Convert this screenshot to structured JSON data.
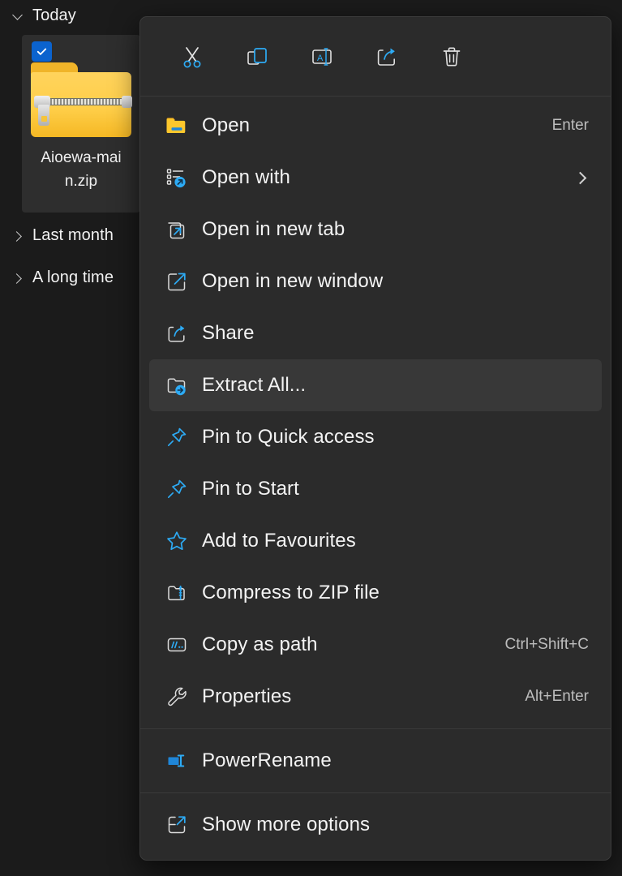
{
  "explorer": {
    "groups": [
      {
        "label": "Today",
        "expanded": true,
        "chevron": "chevron-down-icon"
      },
      {
        "label": "Last month",
        "expanded": false,
        "chevron": "chevron-right-icon"
      },
      {
        "label": "A long time",
        "expanded": false,
        "chevron": "chevron-right-icon"
      }
    ],
    "selected_file": {
      "name": "Aioewa-main.zip",
      "name_line1": "Aioewa-mai",
      "name_line2": "n.zip",
      "icon": "zip-folder-icon",
      "selected": true,
      "check_icon": "checkmark-icon"
    }
  },
  "context_menu": {
    "toolbar": [
      {
        "name": "cut",
        "icon": "scissors-icon",
        "label": "Cut"
      },
      {
        "name": "copy",
        "icon": "copy-icon",
        "label": "Copy"
      },
      {
        "name": "rename",
        "icon": "rename-icon",
        "label": "Rename"
      },
      {
        "name": "share",
        "icon": "share-icon",
        "label": "Share"
      },
      {
        "name": "delete",
        "icon": "trash-icon",
        "label": "Delete"
      }
    ],
    "items": [
      {
        "label": "Open",
        "icon": "folder-open-icon",
        "accel": "Enter",
        "submenu": false,
        "selected": false
      },
      {
        "label": "Open with",
        "icon": "open-with-icon",
        "accel": "",
        "submenu": true,
        "selected": false
      },
      {
        "label": "Open in new tab",
        "icon": "new-tab-icon",
        "accel": "",
        "submenu": false,
        "selected": false
      },
      {
        "label": "Open in new window",
        "icon": "new-window-icon",
        "accel": "",
        "submenu": false,
        "selected": false
      },
      {
        "label": "Share",
        "icon": "share-icon",
        "accel": "",
        "submenu": false,
        "selected": false
      },
      {
        "label": "Extract All...",
        "icon": "extract-all-icon",
        "accel": "",
        "submenu": false,
        "selected": true
      },
      {
        "label": "Pin to Quick access",
        "icon": "pin-icon",
        "accel": "",
        "submenu": false,
        "selected": false
      },
      {
        "label": "Pin to Start",
        "icon": "pin-icon",
        "accel": "",
        "submenu": false,
        "selected": false
      },
      {
        "label": "Add to Favourites",
        "icon": "star-icon",
        "accel": "",
        "submenu": false,
        "selected": false
      },
      {
        "label": "Compress to ZIP file",
        "icon": "compress-zip-icon",
        "accel": "",
        "submenu": false,
        "selected": false
      },
      {
        "label": "Copy as path",
        "icon": "copy-as-path-icon",
        "accel": "Ctrl+Shift+C",
        "submenu": false,
        "selected": false
      },
      {
        "label": "Properties",
        "icon": "wrench-icon",
        "accel": "Alt+Enter",
        "submenu": false,
        "selected": false
      }
    ],
    "extensions": [
      {
        "label": "PowerRename",
        "icon": "powerrename-icon",
        "accel": "",
        "submenu": false,
        "selected": false
      }
    ],
    "footer": [
      {
        "label": "Show more options",
        "icon": "show-more-options-icon",
        "accel": "",
        "submenu": false,
        "selected": false
      }
    ]
  },
  "colors": {
    "menu_background": "#2b2b2b",
    "menu_highlight": "#383838",
    "app_background": "#1b1b1b",
    "tile_background": "#2e2e2e",
    "accent_blue": "#0b63ce",
    "icon_blue": "#2dabf5",
    "text_primary": "#f3f3f3",
    "text_secondary": "#bdbdbd",
    "separator": "#3a3a3a",
    "folder_yellow": "#ffcf4a"
  }
}
